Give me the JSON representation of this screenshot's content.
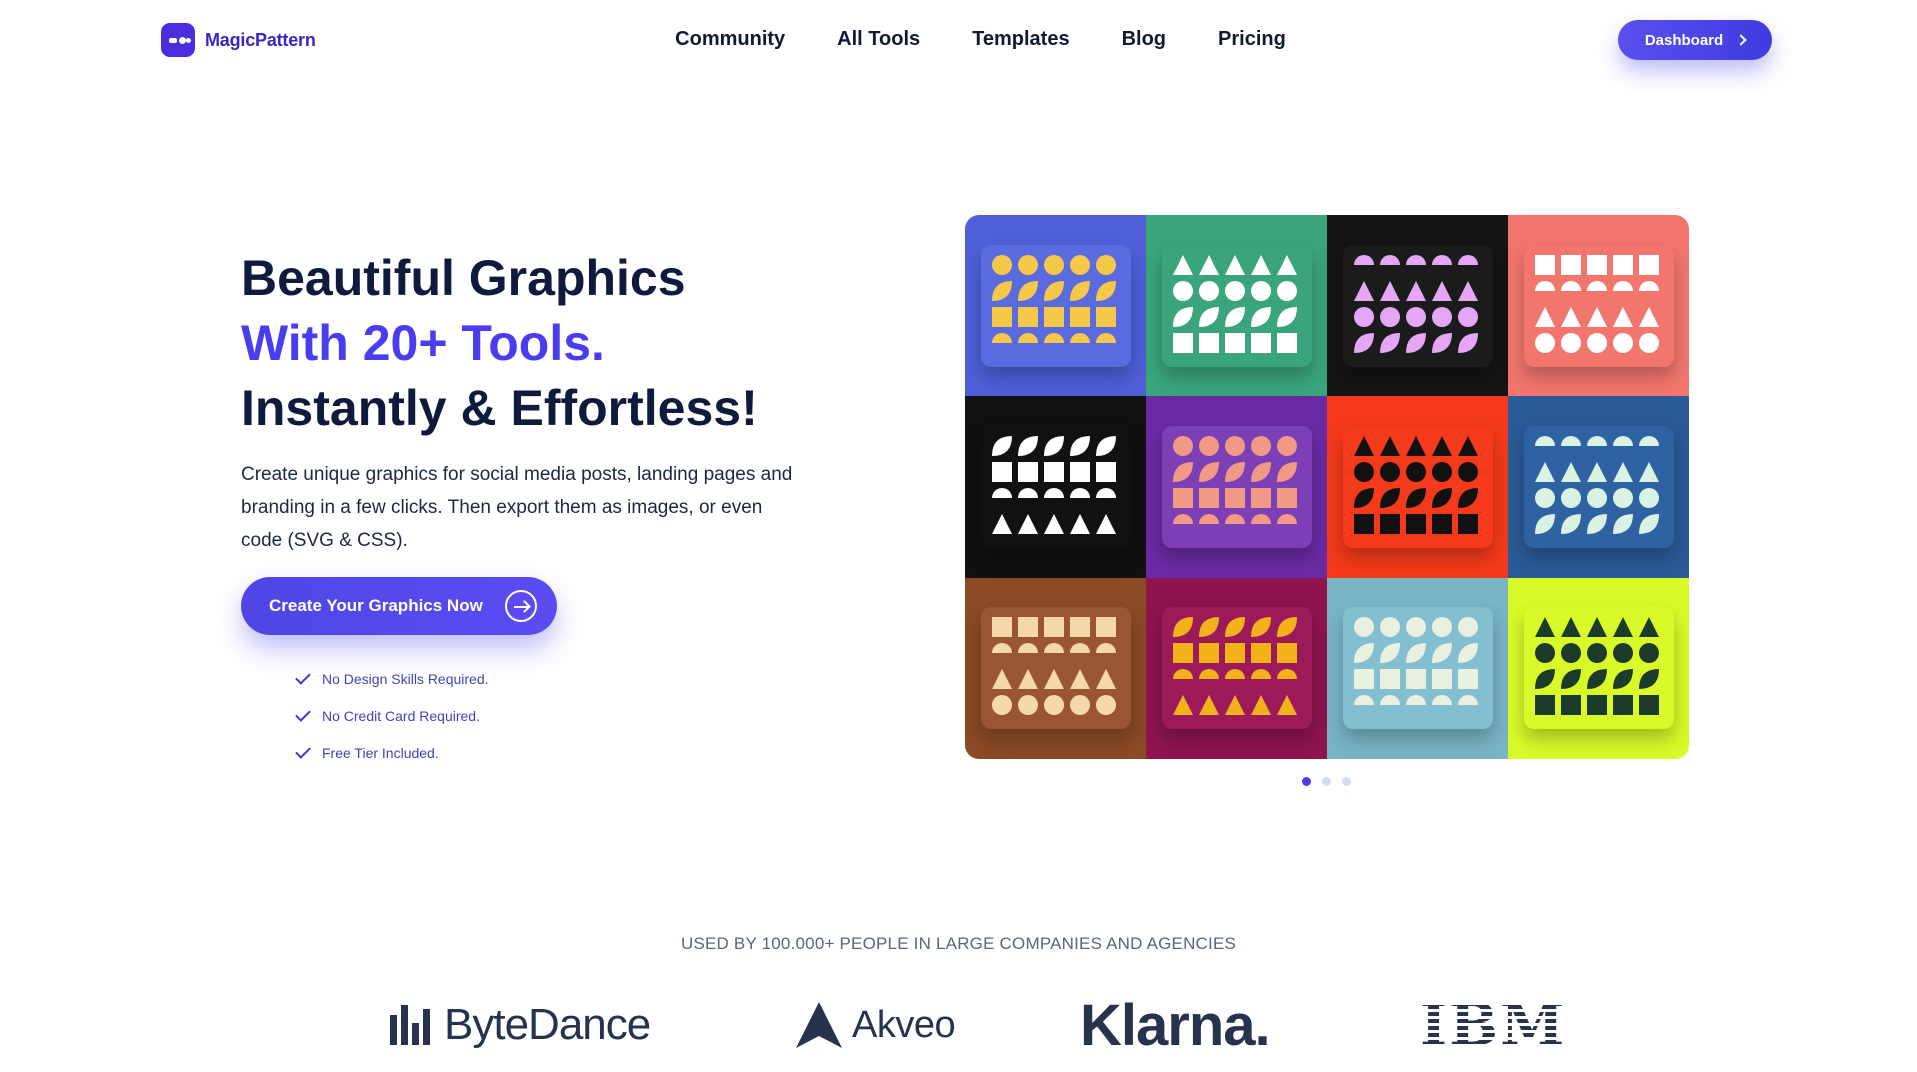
{
  "header": {
    "brand": "MagicPattern",
    "nav": [
      "Community",
      "All Tools",
      "Templates",
      "Blog",
      "Pricing"
    ],
    "dashboard_label": "Dashboard"
  },
  "hero": {
    "title_line1": "Beautiful Graphics",
    "title_line2": "With 20+ Tools.",
    "title_line3": "Instantly & Effortless!",
    "description": "Create unique graphics for social media posts, landing pages and branding in a few clicks. Then export them as images, or even code (SVG & CSS).",
    "cta_label": "Create Your Graphics Now",
    "checks": [
      "No Design Skills Required.",
      "No Credit Card Required.",
      "Free Tier Included."
    ],
    "accent_color": "#4a3df0"
  },
  "gallery": {
    "tiles": [
      {
        "bg": "#4f5fd8",
        "card": "#5a6be0",
        "fg": "#f5c84a"
      },
      {
        "bg": "#3aa57a",
        "card": "#3aa57a",
        "fg": "#ffffff"
      },
      {
        "bg": "#141414",
        "card": "#1b1b1b",
        "fg": "#e5a7f5"
      },
      {
        "bg": "#f2766e",
        "card": "#f2766e",
        "fg": "#ffffff"
      },
      {
        "bg": "#111111",
        "card": "#111111",
        "fg": "#ffffff"
      },
      {
        "bg": "#6a2aa4",
        "card": "#7c3fb5",
        "fg": "#f09a86"
      },
      {
        "bg": "#f43a1a",
        "card": "#f43a1a",
        "fg": "#111111"
      },
      {
        "bg": "#2b5a98",
        "card": "#2f62a2",
        "fg": "#d9f2e2"
      },
      {
        "bg": "#8c4a26",
        "card": "#9a5532",
        "fg": "#f5d9ab"
      },
      {
        "bg": "#8e1450",
        "card": "#9c1a5a",
        "fg": "#f3b21a"
      },
      {
        "bg": "#79b5c6",
        "card": "#83bfd0",
        "fg": "#eaf0e0"
      },
      {
        "bg": "#d9fa28",
        "card": "#d9fa28",
        "fg": "#1d3b2a"
      }
    ],
    "active_page": 0,
    "page_count": 3
  },
  "trust": {
    "text": "USED BY 100.000+ PEOPLE IN LARGE COMPANIES AND AGENCIES",
    "logos": [
      "ByteDance",
      "Akveo",
      "Klarna.",
      "IBM"
    ]
  }
}
